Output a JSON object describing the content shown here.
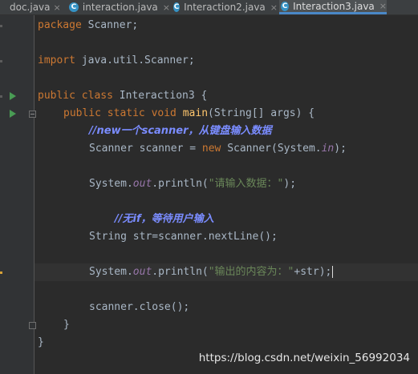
{
  "tabs": [
    {
      "label": "doc.java",
      "active": false,
      "icon": "java-class-icon"
    },
    {
      "label": "interaction.java",
      "active": false,
      "icon": "java-class-icon"
    },
    {
      "label": "Interaction2.java",
      "active": false,
      "icon": "java-class-icon"
    },
    {
      "label": "Interaction3.java",
      "active": true,
      "icon": "java-class-icon"
    }
  ],
  "tab_close_glyph": "×",
  "editor": {
    "lines": {
      "l1_kw": "package",
      "l1_rest": " Scanner;",
      "l3_kw": "import",
      "l3_rest": " java.util.Scanner;",
      "l5_kw": "public class",
      "l5_rest": " Interaction3 {",
      "l6_kw": "public static void",
      "l6_fn": "main",
      "l6_rest": "(String[] args) {",
      "l7_cmt": "//new一个scanner，从键盘输入数据",
      "l8_a": "Scanner scanner = ",
      "l8_kw": "new",
      "l8_b": " Scanner(System.",
      "l8_fld": "in",
      "l8_c": ");",
      "l10_a": "System.",
      "l10_fld": "out",
      "l10_b": ".println(",
      "l10_str": "\"请输入数据：\"",
      "l10_c": ");",
      "l12_cmt": "//无if，等待用户输入",
      "l13": "String str=scanner.nextLine();",
      "l15_a": "System.",
      "l15_fld": "out",
      "l15_b": ".println(",
      "l15_str": "\"输出的内容为：\"",
      "l15_c": "+str);",
      "l17": "scanner.close();",
      "l18": "}",
      "l19": "}"
    }
  },
  "watermark": "https://blog.csdn.net/weixin_56992034",
  "colors": {
    "background": "#2b2b2b",
    "keyword": "#cc7832",
    "method": "#ffc66d",
    "string": "#6a8759",
    "field": "#9876aa",
    "comment": "#7a8cff",
    "run_icon": "#499c54"
  }
}
